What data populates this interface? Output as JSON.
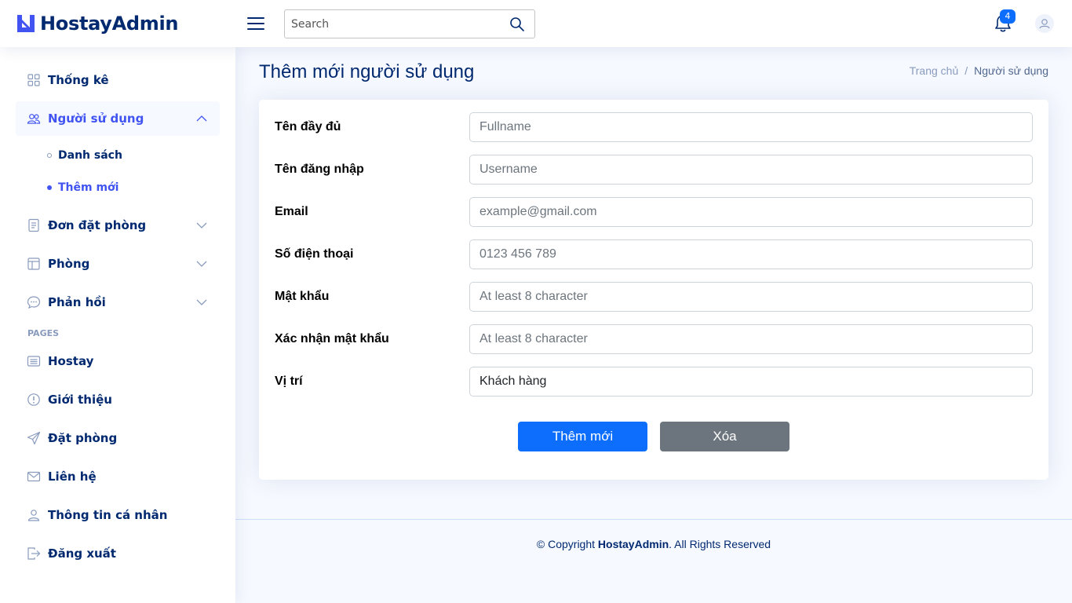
{
  "header": {
    "logo_text": "HostayAdmin",
    "search_placeholder": "Search",
    "notification_count": "4"
  },
  "sidebar": {
    "items": [
      {
        "label": "Thống kê",
        "icon": "grid-icon"
      },
      {
        "label": "Người sử dụng",
        "icon": "people-icon",
        "expanded": true
      },
      {
        "label": "Đơn đặt phòng",
        "icon": "journal-icon"
      },
      {
        "label": "Phòng",
        "icon": "layout-icon"
      },
      {
        "label": "Phản hồi",
        "icon": "chat-icon"
      }
    ],
    "sub_items": [
      {
        "label": "Danh sách"
      },
      {
        "label": "Thêm mới",
        "active": true
      }
    ],
    "pages_heading": "PAGES",
    "pages": [
      {
        "label": "Hostay",
        "icon": "card-list-icon"
      },
      {
        "label": "Giới thiệu",
        "icon": "info-icon"
      },
      {
        "label": "Đặt phòng",
        "icon": "send-icon"
      },
      {
        "label": "Liên hệ",
        "icon": "envelope-icon"
      },
      {
        "label": "Thông tin cá nhân",
        "icon": "person-icon"
      },
      {
        "label": "Đăng xuất",
        "icon": "logout-icon"
      }
    ]
  },
  "main": {
    "title": "Thêm mới người sử dụng",
    "breadcrumb": [
      "Trang chủ",
      "Người sử dụng"
    ],
    "form": [
      {
        "label": "Tên đầy đủ",
        "placeholder": "Fullname",
        "value": ""
      },
      {
        "label": "Tên đăng nhập",
        "placeholder": "Username",
        "value": ""
      },
      {
        "label": "Email",
        "placeholder": "example@gmail.com",
        "value": ""
      },
      {
        "label": "Số điện thoại",
        "placeholder": "0123 456 789",
        "value": ""
      },
      {
        "label": "Mật khẩu",
        "placeholder": "At least 8 character",
        "value": ""
      },
      {
        "label": "Xác nhận mật khẩu",
        "placeholder": "At least 8 character",
        "value": ""
      },
      {
        "label": "Vị trí",
        "placeholder": "",
        "value": "Khách hàng"
      }
    ],
    "submit_label": "Thêm mới",
    "delete_label": "Xóa"
  },
  "footer": {
    "prefix": "© Copyright ",
    "brand": "HostayAdmin",
    "suffix": ". All Rights Reserved"
  },
  "colors": {
    "primary": "#0d6efd",
    "secondary": "#6c757d",
    "brand": "#012970",
    "accent": "#4154f1"
  }
}
